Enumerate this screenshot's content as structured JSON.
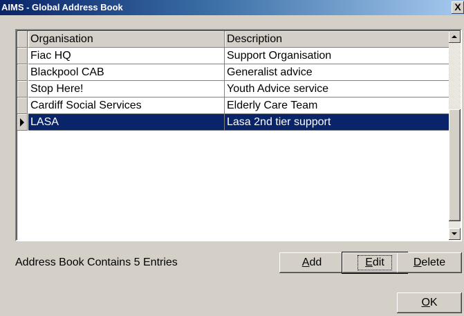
{
  "window": {
    "title": "AIMS - Global Address Book",
    "close_label": "X"
  },
  "grid": {
    "columns": [
      "Organisation",
      "Description"
    ],
    "rows": [
      {
        "organisation": "Fiac HQ",
        "description": "Support Organisation"
      },
      {
        "organisation": "Blackpool CAB",
        "description": "Generalist advice"
      },
      {
        "organisation": "Stop Here!",
        "description": "Youth Advice service"
      },
      {
        "organisation": "Cardiff Social Services",
        "description": "Elderly Care Team"
      },
      {
        "organisation": "LASA",
        "description": "Lasa 2nd tier support"
      }
    ],
    "selected_row": 4
  },
  "status_text": "Address Book Contains 5 Entries",
  "buttons": {
    "add_prefix": "A",
    "add_rest": "dd",
    "edit_prefix": "E",
    "edit_rest": "dit",
    "delete_prefix": "D",
    "delete_rest": "elete",
    "ok_prefix": "O",
    "ok_rest": "K"
  },
  "colors": {
    "title_bar": "#0a246a",
    "selection": "#0a246a",
    "dialog_bg": "#d4d0c8"
  }
}
